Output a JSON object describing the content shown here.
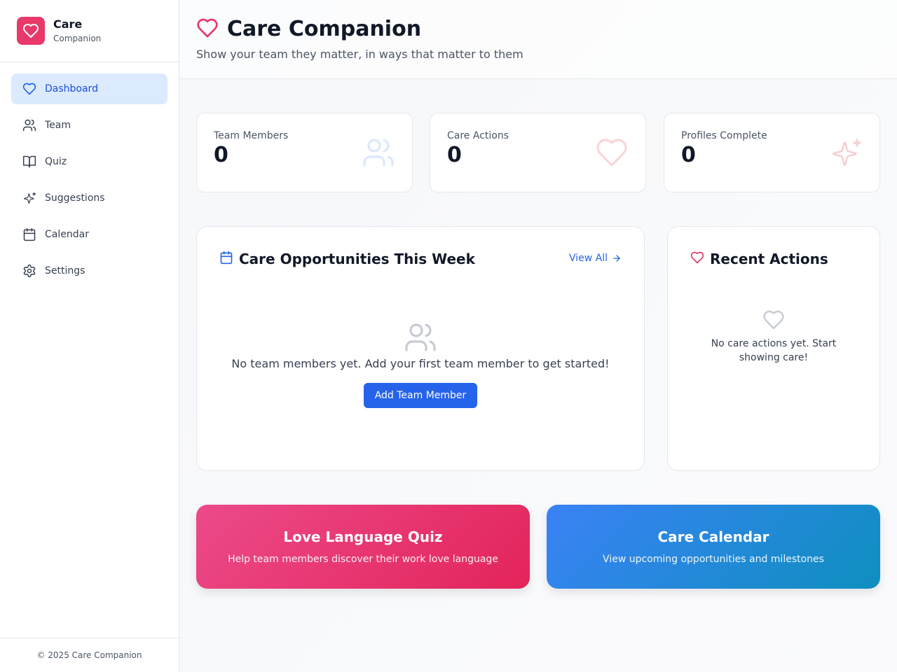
{
  "brand": {
    "name": "Care",
    "sub": "Companion",
    "accent": "#e9386a"
  },
  "nav": [
    {
      "label": "Dashboard",
      "icon": "heart-icon",
      "active": true
    },
    {
      "label": "Team",
      "icon": "users-icon"
    },
    {
      "label": "Quiz",
      "icon": "book-icon"
    },
    {
      "label": "Suggestions",
      "icon": "sparkles-icon"
    },
    {
      "label": "Calendar",
      "icon": "calendar-icon"
    },
    {
      "label": "Settings",
      "icon": "gear-icon"
    }
  ],
  "footer": "© 2025 Care Companion",
  "header": {
    "title": "Care Companion",
    "subtitle": "Show your team they matter, in ways that matter to them"
  },
  "stats": [
    {
      "label": "Team Members",
      "value": "0",
      "icon": "users-icon"
    },
    {
      "label": "Care Actions",
      "value": "0",
      "icon": "heart-icon"
    },
    {
      "label": "Profiles Complete",
      "value": "0",
      "icon": "sparkles-icon"
    }
  ],
  "opportunities": {
    "title": "Care Opportunities This Week",
    "view_all": "View All",
    "empty_text": "No team members yet. Add your first team member to get started!",
    "add_button": "Add Team Member"
  },
  "recent": {
    "title": "Recent Actions",
    "empty_line1": "No care actions yet. Start",
    "empty_line2": "showing care!"
  },
  "cta": {
    "quiz": {
      "title": "Love Language Quiz",
      "sub": "Help team members discover their work love language"
    },
    "calendar": {
      "title": "Care Calendar",
      "sub": "View upcoming opportunities and milestones"
    }
  }
}
